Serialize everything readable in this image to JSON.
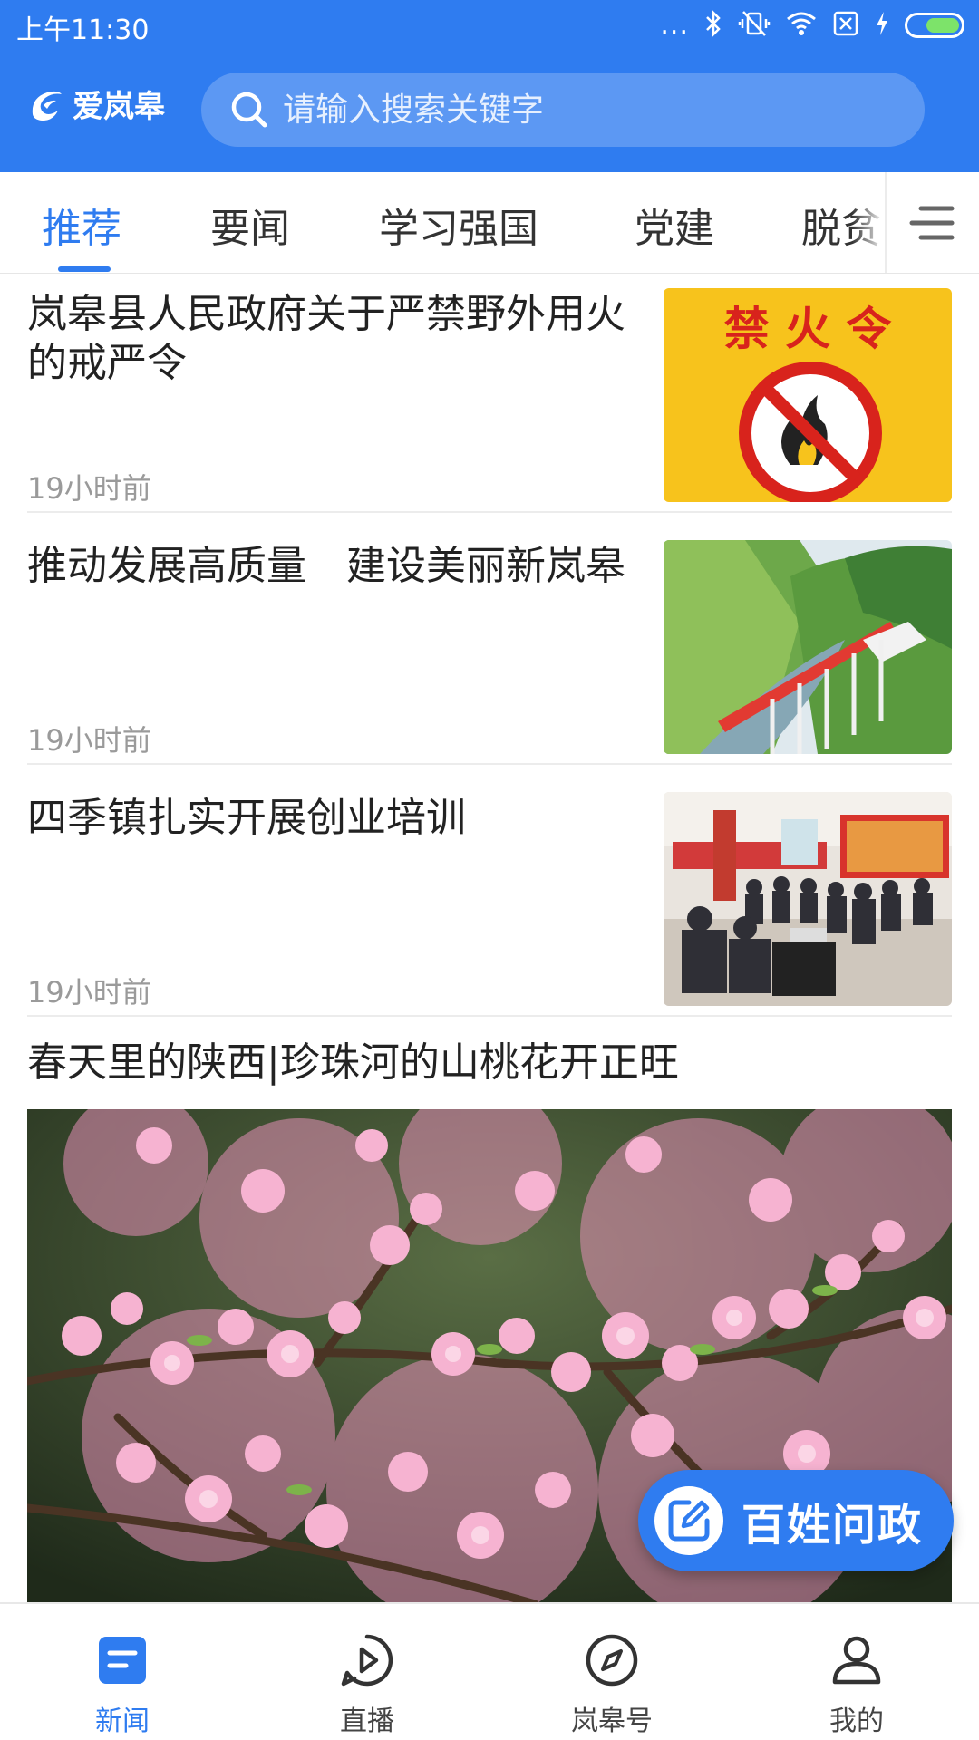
{
  "status_bar": {
    "time": "上午11:30",
    "icons": [
      "more-dots-icon",
      "bluetooth-icon",
      "vibrate-off-icon",
      "wifi-icon",
      "sim-off-icon",
      "charging-icon",
      "battery-icon"
    ],
    "dots": "..."
  },
  "header": {
    "logo_text": "爱岚皋",
    "search_placeholder": "请输入搜索关键字",
    "bg_color": "#2f7cf0"
  },
  "tabs": [
    {
      "label": "推荐",
      "active": true
    },
    {
      "label": "要闻",
      "active": false
    },
    {
      "label": "学习强国",
      "active": false
    },
    {
      "label": "党建",
      "active": false
    },
    {
      "label": "脱贫",
      "active": false
    }
  ],
  "news": [
    {
      "title": "岚皋县人民政府关于严禁野外用火的戒严令",
      "time": "19小时前",
      "thumb_text": "禁 火 令"
    },
    {
      "title": "推动发展高质量　建设美丽新岚皋",
      "time": "19小时前"
    },
    {
      "title": "四季镇扎实开展创业培训",
      "time": "19小时前"
    }
  ],
  "featured": {
    "title": "春天里的陕西|珍珠河的山桃花开正旺"
  },
  "fab": {
    "label": "百姓问政",
    "icon": "edit-icon"
  },
  "bottom_nav": [
    {
      "label": "新闻",
      "icon": "news-icon",
      "active": true
    },
    {
      "label": "直播",
      "icon": "play-icon",
      "active": false
    },
    {
      "label": "岚皋号",
      "icon": "compass-icon",
      "active": false
    },
    {
      "label": "我的",
      "icon": "user-icon",
      "active": false
    }
  ],
  "colors": {
    "accent": "#2f7cf0",
    "muted_text": "#9a9a9a"
  }
}
